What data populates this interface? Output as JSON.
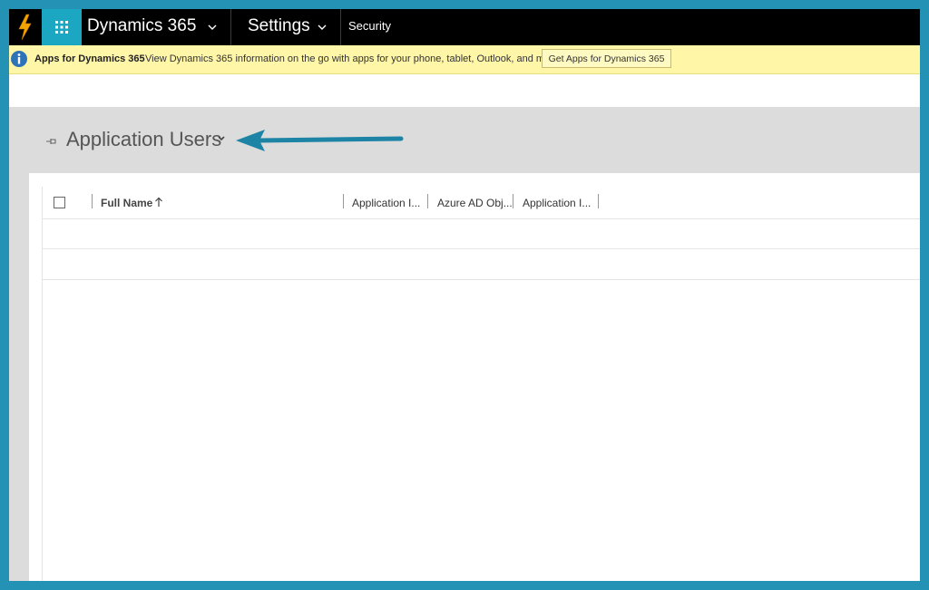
{
  "topbar": {
    "app_name": "Dynamics 365",
    "area": "Settings",
    "subarea": "Security"
  },
  "notification": {
    "title": "Apps for Dynamics 365",
    "message": "View Dynamics 365 information on the go with apps for your phone, tablet, Outlook, and more!",
    "button_label": "Get Apps for Dynamics 365"
  },
  "view": {
    "title": "Application Users"
  },
  "grid": {
    "columns": [
      "Full Name",
      "Application I...",
      "Azure AD Obj...",
      "Application I..."
    ],
    "rows": []
  },
  "colors": {
    "accent": "#1ba6c2",
    "topbar": "#000000",
    "notification_bg": "#fff6a8",
    "annotation_arrow": "#1e84a6"
  }
}
